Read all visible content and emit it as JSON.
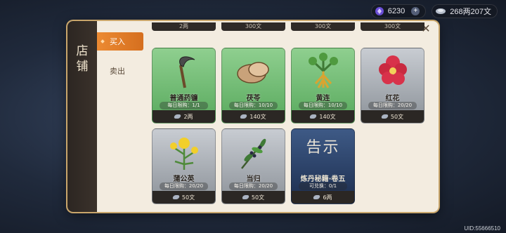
{
  "currency": {
    "gems": {
      "icon": "gem-icon",
      "value": "6230",
      "plus": "+"
    },
    "coins": {
      "icon": "silver-coin-icon",
      "value": "268两207文"
    }
  },
  "panel": {
    "title_chars": [
      "店",
      "铺"
    ],
    "close_icon": "✕",
    "tabs": [
      {
        "label": "买入",
        "active": true
      },
      {
        "label": "卖出",
        "active": false
      }
    ],
    "top_row_prices": [
      "2两",
      "300文",
      "300文",
      "300文"
    ]
  },
  "items": [
    {
      "name": "普通药镰",
      "limit": "每日限购：1/1",
      "price": "2两",
      "rarity": "green",
      "icon": "sickle-icon"
    },
    {
      "name": "茯苓",
      "limit": "每日限购：10/10",
      "price": "140文",
      "rarity": "green",
      "icon": "poria-root-icon"
    },
    {
      "name": "黄连",
      "limit": "每日限购：10/10",
      "price": "140文",
      "rarity": "green",
      "icon": "coptis-herb-icon"
    },
    {
      "name": "红花",
      "limit": "每日限购：20/20",
      "price": "50文",
      "rarity": "gray",
      "icon": "red-flower-icon"
    },
    {
      "name": "蒲公英",
      "limit": "每日限购：20/20",
      "price": "50文",
      "rarity": "gray",
      "icon": "dandelion-icon"
    },
    {
      "name": "当归",
      "limit": "每日限购：20/20",
      "price": "50文",
      "rarity": "gray",
      "icon": "angelica-herb-icon"
    },
    {
      "name": "炼丹秘籍·卷五",
      "limit": "可兑换：0/1",
      "price": "6两",
      "rarity": "blue",
      "icon": "notice-scroll-icon",
      "poster": "告示"
    }
  ],
  "uid": "UID:55666510"
}
